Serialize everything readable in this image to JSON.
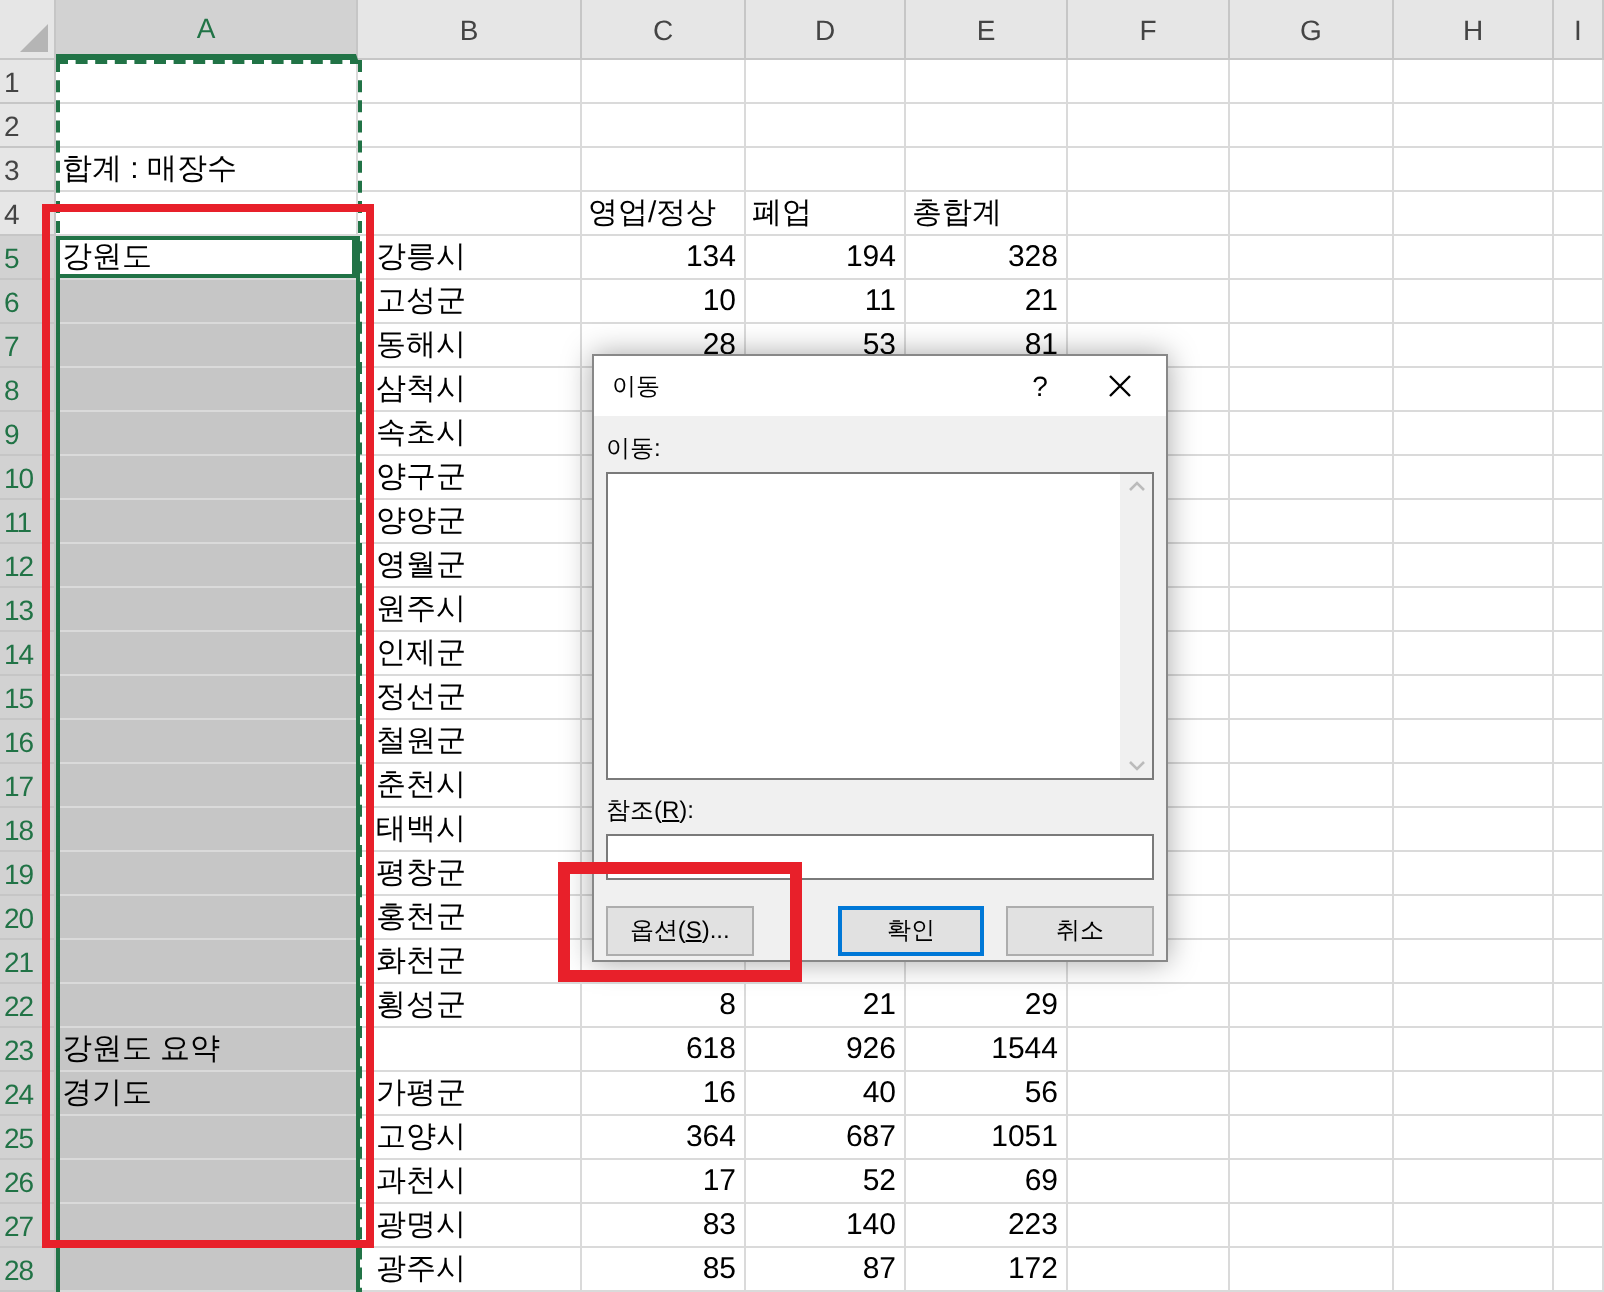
{
  "sheet": {
    "columns": [
      {
        "label": "A",
        "selected": true
      },
      {
        "label": "B",
        "selected": false
      },
      {
        "label": "C",
        "selected": false
      },
      {
        "label": "D",
        "selected": false
      },
      {
        "label": "E",
        "selected": false
      },
      {
        "label": "F",
        "selected": false
      },
      {
        "label": "G",
        "selected": false
      },
      {
        "label": "H",
        "selected": false
      },
      {
        "label": "I",
        "selected": false
      }
    ],
    "rows": [
      {
        "number": "1",
        "selected": false,
        "cells": {}
      },
      {
        "number": "2",
        "selected": false,
        "cells": {}
      },
      {
        "number": "3",
        "selected": false,
        "cells": {
          "a": "합계 : 매장수"
        }
      },
      {
        "number": "4",
        "selected": false,
        "cells": {
          "c": "영업/정상",
          "d": "폐업",
          "e": "총합계"
        }
      },
      {
        "number": "5",
        "selected": true,
        "active": true,
        "cells": {
          "a": "강원도",
          "b": "강릉시",
          "c": "134",
          "d": "194",
          "e": "328"
        }
      },
      {
        "number": "6",
        "selected": true,
        "a_selected": true,
        "cells": {
          "b": "고성군",
          "c": "10",
          "d": "11",
          "e": "21"
        }
      },
      {
        "number": "7",
        "selected": true,
        "a_selected": true,
        "cells": {
          "b": "동해시",
          "c": "28",
          "d": "53",
          "e": "81"
        }
      },
      {
        "number": "8",
        "selected": true,
        "a_selected": true,
        "cells": {
          "b": "삼척시"
        }
      },
      {
        "number": "9",
        "selected": true,
        "a_selected": true,
        "cells": {
          "b": "속초시"
        }
      },
      {
        "number": "10",
        "selected": true,
        "a_selected": true,
        "cells": {
          "b": "양구군"
        }
      },
      {
        "number": "11",
        "selected": true,
        "a_selected": true,
        "cells": {
          "b": "양양군"
        }
      },
      {
        "number": "12",
        "selected": true,
        "a_selected": true,
        "cells": {
          "b": "영월군"
        }
      },
      {
        "number": "13",
        "selected": true,
        "a_selected": true,
        "cells": {
          "b": "원주시"
        }
      },
      {
        "number": "14",
        "selected": true,
        "a_selected": true,
        "cells": {
          "b": "인제군"
        }
      },
      {
        "number": "15",
        "selected": true,
        "a_selected": true,
        "cells": {
          "b": "정선군"
        }
      },
      {
        "number": "16",
        "selected": true,
        "a_selected": true,
        "cells": {
          "b": "철원군"
        }
      },
      {
        "number": "17",
        "selected": true,
        "a_selected": true,
        "cells": {
          "b": "춘천시"
        }
      },
      {
        "number": "18",
        "selected": true,
        "a_selected": true,
        "cells": {
          "b": "태백시"
        }
      },
      {
        "number": "19",
        "selected": true,
        "a_selected": true,
        "cells": {
          "b": "평창군"
        }
      },
      {
        "number": "20",
        "selected": true,
        "a_selected": true,
        "cells": {
          "b": "홍천군"
        }
      },
      {
        "number": "21",
        "selected": true,
        "a_selected": true,
        "cells": {
          "b": "화천군"
        }
      },
      {
        "number": "22",
        "selected": true,
        "a_selected": true,
        "cells": {
          "b": "횡성군",
          "c": "8",
          "d": "21",
          "e": "29"
        }
      },
      {
        "number": "23",
        "selected": true,
        "a_selected": true,
        "cells": {
          "a": "강원도 요약",
          "c": "618",
          "d": "926",
          "e": "1544"
        }
      },
      {
        "number": "24",
        "selected": true,
        "a_selected": true,
        "cells": {
          "a": "경기도",
          "b": "가평군",
          "c": "16",
          "d": "40",
          "e": "56"
        }
      },
      {
        "number": "25",
        "selected": true,
        "a_selected": true,
        "cells": {
          "b": "고양시",
          "c": "364",
          "d": "687",
          "e": "1051"
        }
      },
      {
        "number": "26",
        "selected": true,
        "a_selected": true,
        "cells": {
          "b": "과천시",
          "c": "17",
          "d": "52",
          "e": "69"
        }
      },
      {
        "number": "27",
        "selected": true,
        "a_selected": true,
        "cells": {
          "b": "광명시",
          "c": "83",
          "d": "140",
          "e": "223"
        }
      },
      {
        "number": "28",
        "selected": true,
        "a_selected": true,
        "cells": {
          "b": "광주시",
          "c": "85",
          "d": "87",
          "e": "172"
        }
      }
    ]
  },
  "dialog": {
    "title": "이동",
    "help": "?",
    "list_label": "이동:",
    "reference_label": "참조(R):",
    "buttons": [
      {
        "label": "옵션(S)...",
        "default": false
      },
      {
        "label": "확인",
        "default": true
      },
      {
        "label": "취소",
        "default": false
      }
    ]
  }
}
